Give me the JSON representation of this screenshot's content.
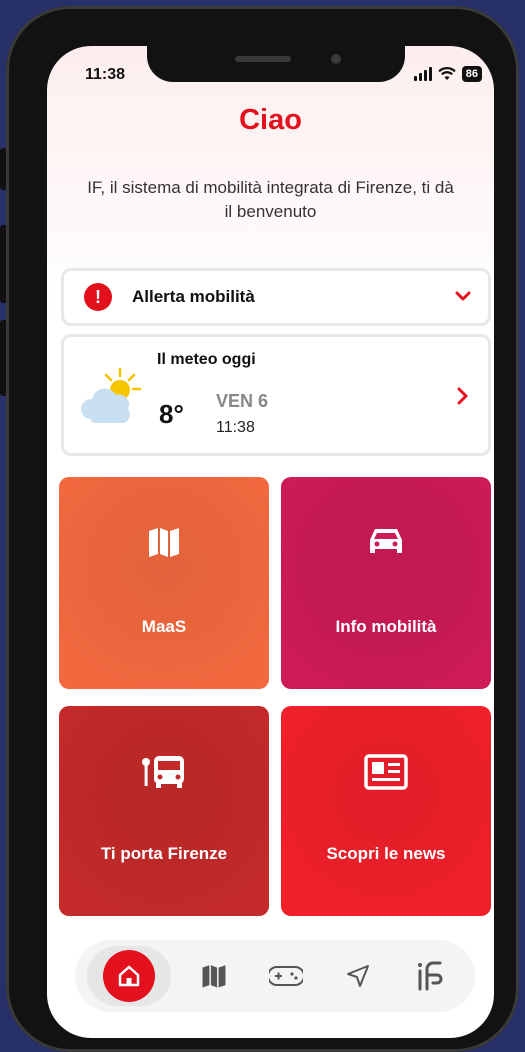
{
  "status_bar": {
    "time": "11:38",
    "battery": "86"
  },
  "greeting": "Ciao",
  "subtitle": "IF, il sistema di mobilità integrata di Firenze, ti dà il benvenuto",
  "alert": {
    "label": "Allerta mobilità",
    "icon": "exclamation-icon"
  },
  "weather": {
    "title": "Il meteo oggi",
    "temperature": "8°",
    "day": "VEN 6",
    "time": "11:38",
    "icon": "partly-cloudy-icon"
  },
  "tiles": [
    {
      "label": "MaaS",
      "icon": "map-icon",
      "color": "#f2693f"
    },
    {
      "label": "Info mobilità",
      "icon": "car-icon",
      "color": "#cc1b55"
    },
    {
      "label": "Ti porta Firenze",
      "icon": "bus-stop-icon",
      "color": "#c42a2a"
    },
    {
      "label": "Scopri le news",
      "icon": "newspaper-icon",
      "color": "#f0202a"
    }
  ],
  "tabbar": {
    "items": [
      {
        "name": "home",
        "icon": "home-icon",
        "active": true
      },
      {
        "name": "map",
        "icon": "map-icon",
        "active": false
      },
      {
        "name": "games",
        "icon": "gamepad-icon",
        "active": false
      },
      {
        "name": "navigate",
        "icon": "navigation-arrow-icon",
        "active": false
      },
      {
        "name": "if",
        "icon": "if-logo-icon",
        "active": false
      }
    ]
  },
  "colors": {
    "brand_red": "#e3101d",
    "background": "#28306a"
  }
}
